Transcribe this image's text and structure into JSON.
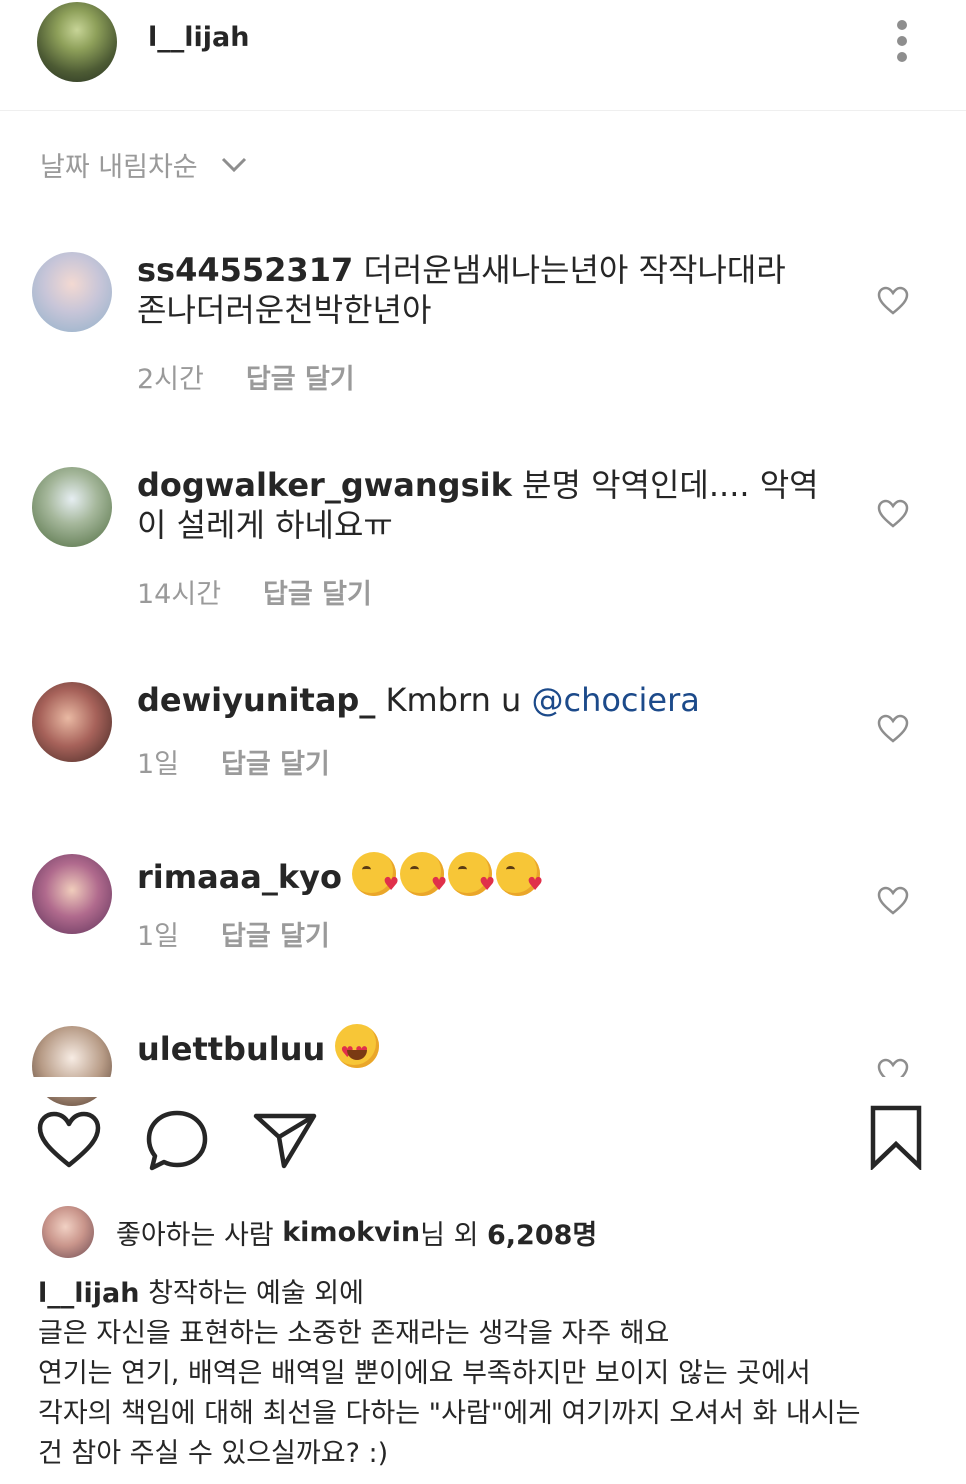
{
  "header": {
    "username": "l__lijah"
  },
  "sort": {
    "label": "날짜 내림차순"
  },
  "comments": [
    {
      "username": "ss44552317",
      "text": "더러운냄새나는년아  작작나대라",
      "text2": "존나더러운천박한년아",
      "time": "2시간",
      "reply": "답글 달기"
    },
    {
      "username": "dogwalker_gwangsik",
      "text": "분명 악역인데.... 악역",
      "text2": "이 설레게 하네요ㅠ",
      "time": "14시간",
      "reply": "답글 달기"
    },
    {
      "username": "dewiyunitap_",
      "text": "Kmbrn u",
      "mention": "@chociera",
      "time": "1일",
      "reply": "답글 달기"
    },
    {
      "username": "rimaaa_kyo",
      "emojis": [
        "face-blowing-kiss",
        "face-blowing-kiss",
        "face-blowing-kiss",
        "face-blowing-kiss"
      ],
      "time": "1일",
      "reply": "답글 달기"
    },
    {
      "username": "ulettbuluu",
      "emojis": [
        "smiling-face-with-heart-eyes"
      ]
    }
  ],
  "likes": {
    "prefix": "좋아하는 사람",
    "user": "kimokvin",
    "suffix1": "님 외",
    "count": "6,208명"
  },
  "caption": {
    "username": "l__lijah",
    "line1": "창작하는 예술 외에",
    "line2": "글은 자신을 표현하는 소중한 존재라는 생각을 자주 해요",
    "line3": "연기는 연기, 배역은 배역일 뿐이에요 부족하지만 보이지 않는 곳에서",
    "line4": "각자의 책임에 대해 최선을 다하는 \"사람\"에게 여기까지 오셔서 화 내시는",
    "line5": "건 참아 주실 수 있으실까요? :)"
  },
  "icons": [
    "more-vertical-icon",
    "chevron-down-icon",
    "heart-icon",
    "comment-icon",
    "share-icon",
    "bookmark-icon"
  ]
}
